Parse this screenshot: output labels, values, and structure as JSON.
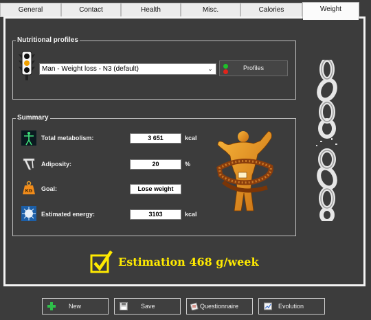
{
  "tabs": [
    {
      "label": "General"
    },
    {
      "label": "Contact"
    },
    {
      "label": "Health"
    },
    {
      "label": "Misc."
    },
    {
      "label": "Calories"
    },
    {
      "label": "Weight",
      "active": true
    }
  ],
  "nutritional_profiles": {
    "legend": "Nutritional profiles",
    "selected_profile": "Man - Weight loss - N3 (default)",
    "profiles_button": "Profiles"
  },
  "summary": {
    "legend": "Summary",
    "rows": [
      {
        "label": "Total metabolism:",
        "value": "3 651",
        "unit": "kcal",
        "icon": "body-figure-icon"
      },
      {
        "label": "Adiposity:",
        "value": "20",
        "unit": "%",
        "icon": "caliper-icon"
      },
      {
        "label": "Goal:",
        "value": "Lose weight",
        "unit": "",
        "icon": "kg-weight-icon"
      },
      {
        "label": "Estimated energy:",
        "value": "3103",
        "unit": "kcal",
        "icon": "energy-burst-icon"
      }
    ]
  },
  "estimation": {
    "text": "Estimation 468 g/week"
  },
  "buttons": {
    "new": "New",
    "save": "Save",
    "questionnaire": "Questionnaire",
    "evolution": "Evolution"
  },
  "colors": {
    "background": "#3c3c3c",
    "estimation_text": "#ffea00",
    "panel_border": "#f4f4f4"
  }
}
